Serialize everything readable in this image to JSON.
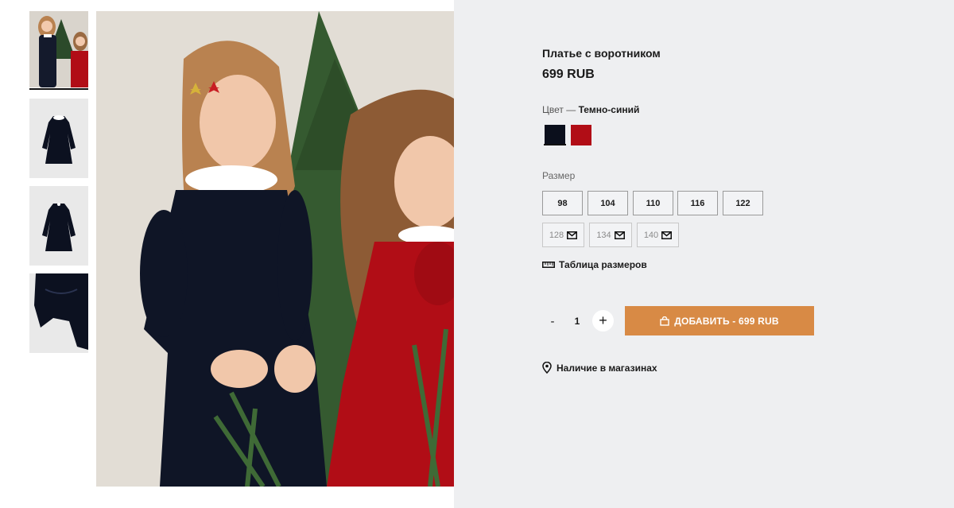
{
  "product": {
    "title": "Платье с воротником",
    "price": "699 RUB"
  },
  "color": {
    "label": "Цвет —",
    "selected": "Темно-синий",
    "swatches": [
      {
        "name": "navy",
        "hex": "#0b0f1c"
      },
      {
        "name": "red",
        "hex": "#b10d16"
      }
    ]
  },
  "size": {
    "label": "Размер",
    "available": [
      "98",
      "104",
      "110",
      "116",
      "122"
    ],
    "unavailable": [
      "128",
      "134",
      "140"
    ]
  },
  "size_table_label": "Таблица размеров",
  "quantity": {
    "minus": "-",
    "value": "1",
    "plus": "+"
  },
  "add_to_cart_label": "ДОБАВИТЬ - 699 RUB",
  "stores_label": "Наличие в магазинах",
  "colors": {
    "accent": "#d88a45",
    "background": "#eeeff1"
  }
}
